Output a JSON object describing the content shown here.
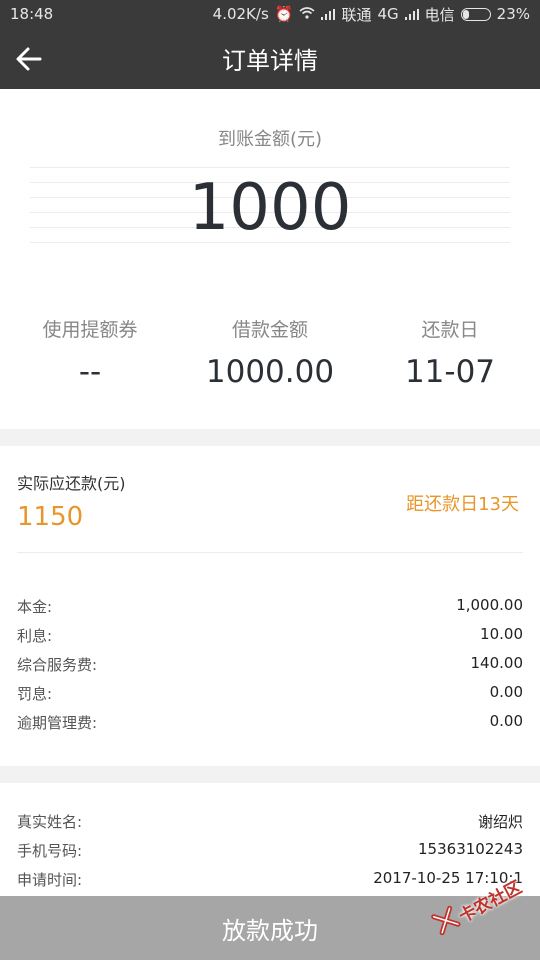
{
  "status_bar": {
    "time": "18:48",
    "speed": "4.02K/s",
    "carrier1": "联通",
    "network": "4G",
    "carrier2": "电信",
    "battery": "23%",
    "battery_level": 0.23
  },
  "header": {
    "title": "订单详情",
    "back_icon": "arrow-left-icon"
  },
  "summary": {
    "received_label": "到账金额(元)",
    "received_amount": "1000",
    "coupon_label": "使用提额券",
    "coupon_value": "--",
    "loan_label": "借款金额",
    "loan_value": "1000.00",
    "due_date_label": "还款日",
    "due_date_value": "11-07"
  },
  "repayment": {
    "due_label": "实际应还款(元)",
    "due_amount": "1150",
    "countdown": "距还款日13天",
    "items": [
      {
        "label": "本金:",
        "value": "1,000.00"
      },
      {
        "label": "利息:",
        "value": "10.00"
      },
      {
        "label": "综合服务费:",
        "value": "140.00"
      },
      {
        "label": "罚息:",
        "value": "0.00"
      },
      {
        "label": "逾期管理费:",
        "value": "0.00"
      }
    ]
  },
  "applicant": {
    "items": [
      {
        "label": "真实姓名:",
        "value": "谢绍炽"
      },
      {
        "label": "手机号码:",
        "value": "15363102243"
      },
      {
        "label": "申请时间:",
        "value": "2017-10-25 17:10:1"
      }
    ]
  },
  "footer": {
    "status_button": "放款成功"
  },
  "watermark": {
    "text": "卡农社区"
  },
  "colors": {
    "bar": "#3a3a3a",
    "accent": "#e8962b",
    "button": "#a6a6a6",
    "watermark": "#c0322a"
  }
}
